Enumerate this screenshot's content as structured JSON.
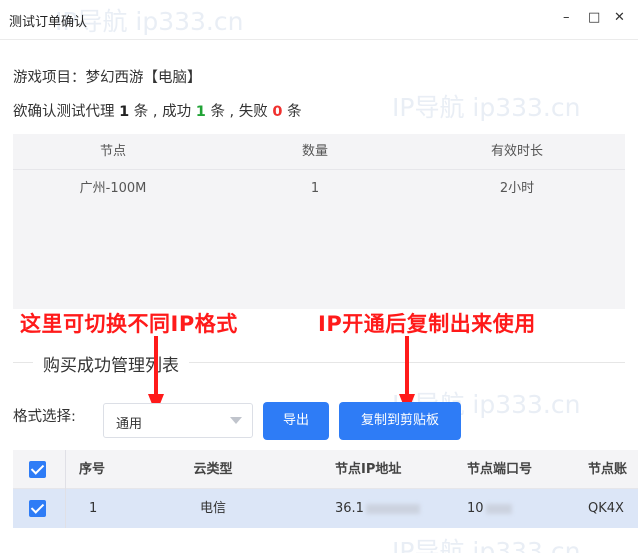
{
  "window": {
    "title": "测试订单确认",
    "min_glyph": "–",
    "max_glyph": "□",
    "close_glyph": "✕"
  },
  "order": {
    "project_line": "游戏项目：梦幻西游【电脑】",
    "summary_prefix": "欲确认测试代理 ",
    "total": "1",
    "summary_mid1": " 条 , 成功 ",
    "success": "1",
    "summary_mid2": " 条 , 失败 ",
    "fail": "0",
    "summary_suffix": " 条"
  },
  "node_table": {
    "headers": [
      "节点",
      "数量",
      "有效时长"
    ],
    "rows": [
      [
        "广州-100M",
        "1",
        "2小时"
      ]
    ]
  },
  "annotations": {
    "left": "这里可切换不同IP格式",
    "right": "IP开通后复制出来使用",
    "color": "#ff1a1a"
  },
  "purchase": {
    "section_title": "购买成功管理列表",
    "format_label": "格式选择:",
    "format_value": "通用",
    "export_label": "导出",
    "copy_label": "复制到剪贴板"
  },
  "result_table": {
    "headers": [
      "序号",
      "云类型",
      "节点IP地址",
      "节点端口号",
      "节点账"
    ],
    "rows": [
      {
        "seq": "1",
        "type": "电信",
        "ip_visible": "36.1",
        "port_visible": "10",
        "account_visible": "QK4X"
      }
    ]
  },
  "watermark": "IP导航  ip333.cn",
  "colors": {
    "primary": "#2e7cf6",
    "success": "#21a336",
    "fail": "#f0302e",
    "selected_row": "#dce6f7"
  }
}
